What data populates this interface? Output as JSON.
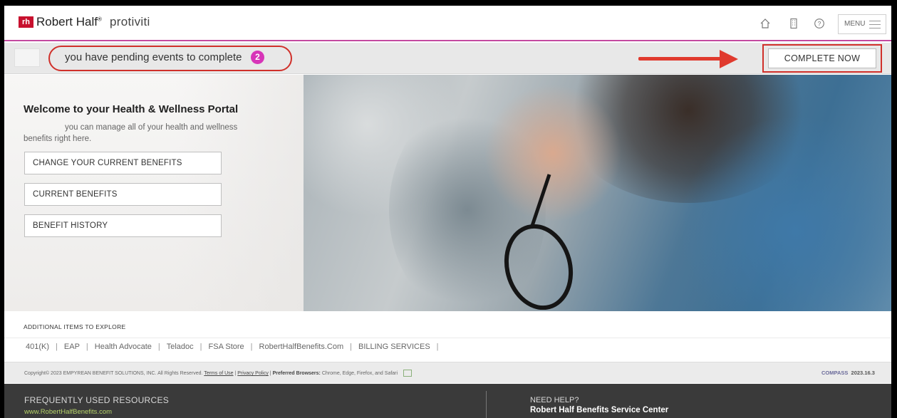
{
  "header": {
    "logo_mark": "rh",
    "brand_primary": "Robert Half",
    "brand_secondary": "protiviti",
    "icons": [
      "home-icon",
      "building-icon",
      "help-icon"
    ],
    "menu_label": "MENU"
  },
  "pending": {
    "message": "you have pending events to complete",
    "count": "2",
    "cta_label": "COMPLETE NOW"
  },
  "hero": {
    "title": "Welcome to your Health & Wellness Portal",
    "subtitle": "you can manage all of your health and wellness benefits right here.",
    "buttons": [
      "CHANGE YOUR CURRENT BENEFITS",
      "CURRENT BENEFITS",
      "BENEFIT HISTORY"
    ]
  },
  "additional": {
    "title": "ADDITIONAL ITEMS TO EXPLORE",
    "links": [
      "401(K)",
      "EAP",
      "Health Advocate",
      "Teladoc",
      "FSA Store",
      "RobertHalfBenefits.Com",
      "BILLING SERVICES"
    ]
  },
  "copyright": {
    "text": "Copyright© 2023 EMPYREAN BENEFIT SOLUTIONS, INC. All Rights Reserved.",
    "terms": "Terms of Use",
    "privacy": "Privacy Policy",
    "browsers_label": "Preferred Browsers:",
    "browsers": "Chrome, Edge, Firefox, and Safari",
    "compass_brand": "COMPASS",
    "version": "2023.16.3"
  },
  "footer": {
    "resources_title": "FREQUENTLY USED RESOURCES",
    "resources_link": "www.RobertHalfBenefits.com",
    "help_title": "NEED HELP?",
    "help_sub": "Robert Half Benefits Service Center"
  },
  "colors": {
    "accent_magenta": "#c44aa0",
    "badge": "#d735b8",
    "annotation_red": "#d0302a",
    "footer_bg": "#3a3a3a",
    "footer_link": "#b7d36a"
  }
}
